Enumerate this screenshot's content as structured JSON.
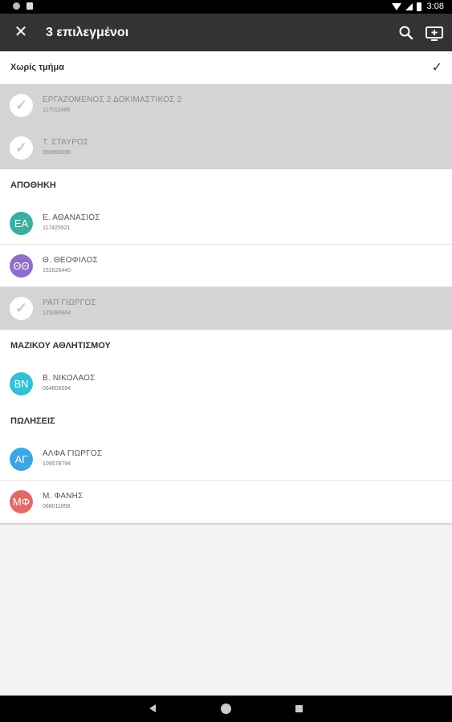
{
  "status_bar": {
    "time": "3:08"
  },
  "appbar": {
    "title": "3 επιλεγμένοι",
    "close_icon": "close-icon",
    "search_icon": "search-icon",
    "add_icon": "add-to-queue-icon"
  },
  "sections": [
    {
      "title": "Χωρίς τμήμα",
      "has_check": true,
      "rows": [
        {
          "initials": "",
          "name": "ΕΡΓΑΖΟΜΕΝΟΣ 2 ΔΟΚΙΜΑΣΤΙΚΟΣ 2",
          "code": "117012485",
          "selected": true,
          "color": ""
        },
        {
          "initials": "",
          "name": "Τ. ΣΤΑΥΡΟΣ",
          "code": "556988096",
          "selected": true,
          "color": ""
        }
      ]
    },
    {
      "title": "ΑΠΟΘΗΚΗ",
      "has_check": false,
      "rows": [
        {
          "initials": "ΕΑ",
          "name": "Ε. ΑΘΑΝΑΣΙΟΣ",
          "code": "117425521",
          "selected": false,
          "color": "#3aaf9e"
        },
        {
          "initials": "ΘΘ",
          "name": "Θ. ΘΕΟΦΙΛΟΣ",
          "code": "152626440",
          "selected": false,
          "color": "#8e6fc9"
        },
        {
          "initials": "",
          "name": "ΡΑΠ ΓΙΩΡΓΟΣ",
          "code": "125086964",
          "selected": true,
          "color": ""
        }
      ]
    },
    {
      "title": "ΜΑΖΙΚΟΥ ΑΘΛΗΤΙΣΜΟΥ",
      "has_check": false,
      "rows": [
        {
          "initials": "ΒΝ",
          "name": "Β. ΝΙΚΟΛΑΟΣ",
          "code": "064606594",
          "selected": false,
          "color": "#33bfd6"
        }
      ]
    },
    {
      "title": "ΠΩΛΗΣΕΙΣ",
      "has_check": false,
      "rows": [
        {
          "initials": "ΑΓ",
          "name": "ΑΛΦΑ ΓΙΩΡΓΟΣ",
          "code": "109578794",
          "selected": false,
          "color": "#3ca6e0"
        },
        {
          "initials": "ΜΦ",
          "name": "Μ. ΦΑΝΗΣ",
          "code": "066011858",
          "selected": false,
          "color": "#e06b66"
        }
      ]
    }
  ],
  "colors": {
    "appbar": "#333333",
    "selected_row": "#d4d4d4",
    "background": "#f4f4f4"
  }
}
